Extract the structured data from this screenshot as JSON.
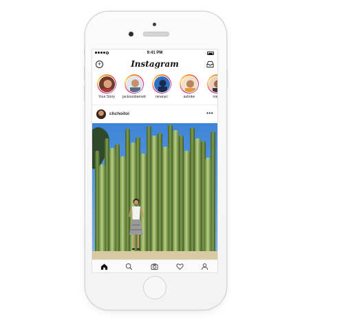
{
  "status_bar": {
    "time": "9:41 PM"
  },
  "app": {
    "brand": "Instagram"
  },
  "stories": [
    {
      "label": "Your Story",
      "own": true
    },
    {
      "label": "jacksonbarnett"
    },
    {
      "label": "ninanyc"
    },
    {
      "label": "ashoke"
    },
    {
      "label": "minz"
    }
  ],
  "post": {
    "username": "chchoitoi",
    "more": "•••"
  },
  "colors": {
    "story_ring": "#dd2a7b",
    "sky": "#4a8fd6",
    "cactus": "#8fae5c",
    "ground": "#d9c9a3"
  },
  "icons": {
    "top_left": "add-story-icon",
    "top_right": "inbox-icon",
    "tabs": [
      "home-icon",
      "search-icon",
      "camera-icon",
      "heart-icon",
      "profile-icon"
    ]
  }
}
